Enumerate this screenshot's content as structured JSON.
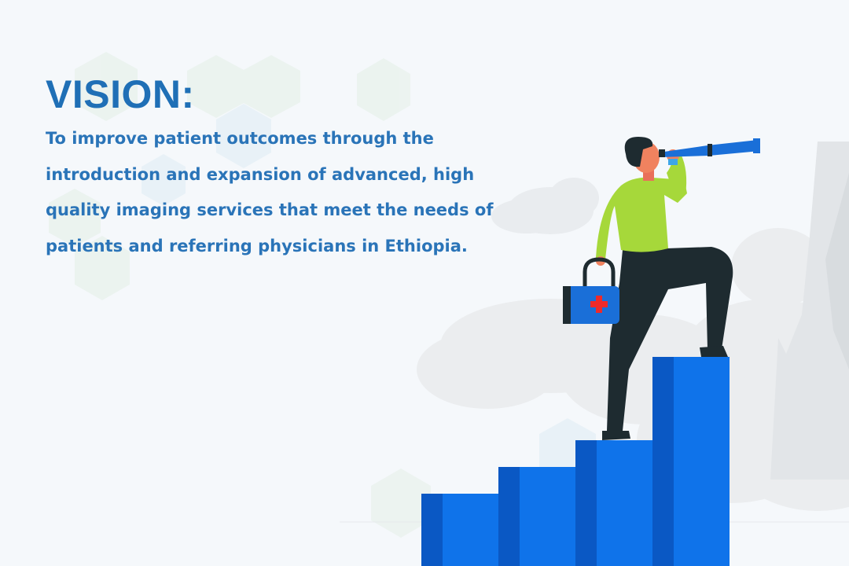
{
  "vision": {
    "heading": "VISION:",
    "statement": "To improve patient outcomes through the introduction and expansion of advanced, high quality imaging services that meet the needs of patients and referring physicians in Ethiopia."
  },
  "colors": {
    "heading_blue": "#1f6fb6",
    "text_blue": "#2a74b8",
    "stair_blue": "#0f73ea",
    "shirt_green": "#a6d83a"
  },
  "icons": {
    "hexagons": "hexagon-pattern",
    "bag": "medical-bag-icon",
    "telescope": "telescope-icon"
  }
}
